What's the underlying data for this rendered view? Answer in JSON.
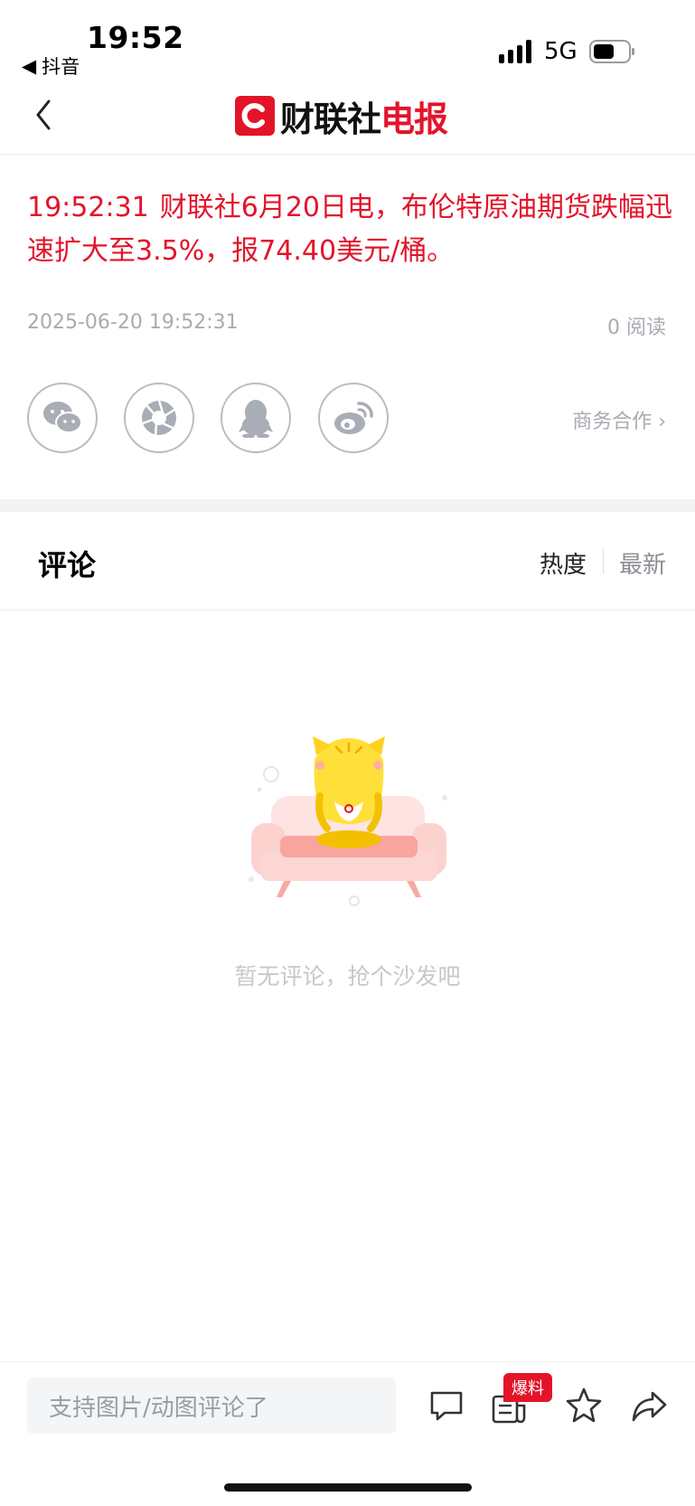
{
  "status_bar": {
    "time": "19:52",
    "back_app": "抖音",
    "network": "5G"
  },
  "header": {
    "logo_letter": "C",
    "brand_black": "财联社",
    "brand_red": "电报"
  },
  "article": {
    "time": "19:52:31",
    "body": "财联社6月20日电，布伦特原油期货跌幅迅速扩大至3.5%，报74.40美元/桶。",
    "date": "2025-06-20 19:52:31",
    "reads": "0 阅读"
  },
  "share": {
    "business_link": "商务合作 ›"
  },
  "comments": {
    "title": "评论",
    "sort_hot": "热度",
    "sort_new": "最新",
    "empty_text": "暂无评论，抢个沙发吧"
  },
  "bottom_bar": {
    "input_placeholder": "支持图片/动图评论了",
    "tip_badge": "爆料"
  },
  "colors": {
    "brand_red": "#e3142a",
    "muted": "#a8abb2"
  },
  "icons": [
    "wechat-icon",
    "moments-icon",
    "qq-icon",
    "weibo-icon",
    "comment-icon",
    "news-tip-icon",
    "star-icon",
    "share-icon"
  ]
}
